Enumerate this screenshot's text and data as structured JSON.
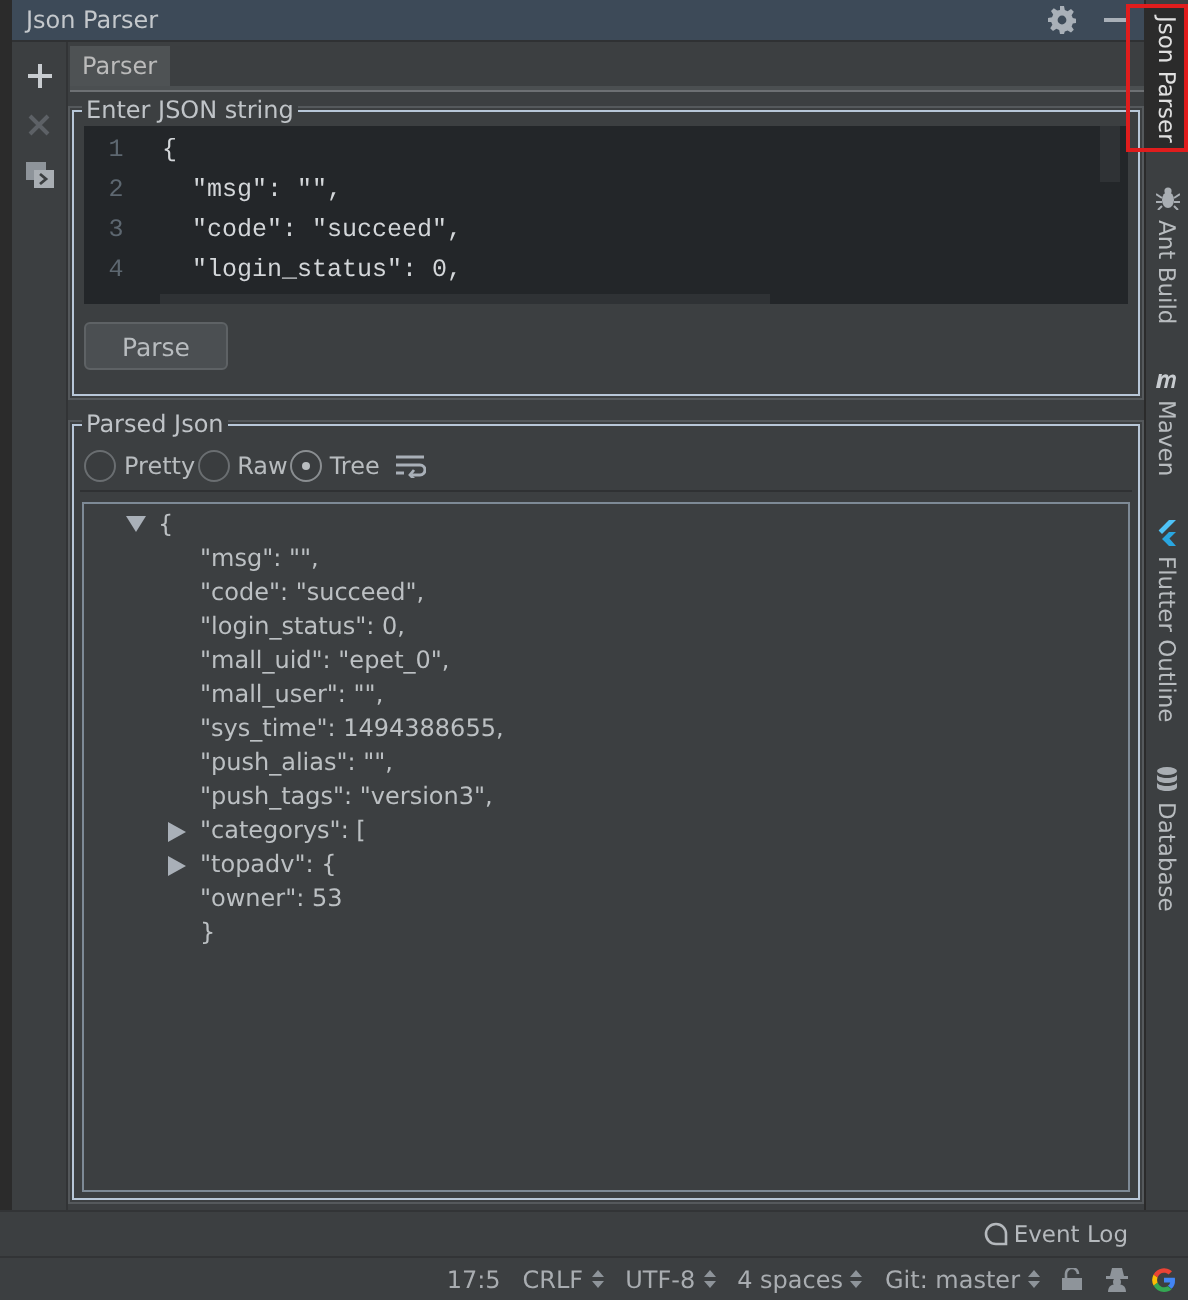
{
  "window": {
    "title": "Json Parser"
  },
  "tabs": [
    {
      "label": "Parser",
      "selected": true
    }
  ],
  "input_group": {
    "title": "Enter JSON string",
    "lines": [
      {
        "number": "1",
        "text": "{"
      },
      {
        "number": "2",
        "text": "  \"msg\": \"\","
      },
      {
        "number": "3",
        "text": "  \"code\": \"succeed\","
      },
      {
        "number": "4",
        "text": "  \"login_status\": 0,"
      }
    ]
  },
  "parse_button": "Parse",
  "output_group": {
    "title": "Parsed Json",
    "view_modes": [
      {
        "label": "Pretty",
        "selected": false
      },
      {
        "label": "Raw",
        "selected": false
      },
      {
        "label": "Tree",
        "selected": true
      }
    ]
  },
  "tree": {
    "open": "{",
    "expanded": true,
    "close": "}",
    "children": [
      {
        "kind": "leaf",
        "text": "\"msg\": \"\","
      },
      {
        "kind": "leaf",
        "text": "\"code\": \"succeed\","
      },
      {
        "kind": "leaf",
        "text": "\"login_status\": 0,"
      },
      {
        "kind": "leaf",
        "text": "\"mall_uid\": \"epet_0\","
      },
      {
        "kind": "leaf",
        "text": "\"mall_user\": \"\","
      },
      {
        "kind": "leaf",
        "text": "\"sys_time\": 1494388655,"
      },
      {
        "kind": "leaf",
        "text": "\"push_alias\": \"\","
      },
      {
        "kind": "leaf",
        "text": "\"push_tags\": \"version3\","
      },
      {
        "kind": "node",
        "text": "\"categorys\": [",
        "expanded": false
      },
      {
        "kind": "node",
        "text": "\"topadv\": {",
        "expanded": false
      },
      {
        "kind": "leaf",
        "text": "\"owner\": 53"
      }
    ]
  },
  "right_tabs": [
    {
      "label": "Json Parser",
      "selected": true,
      "highlighted": true,
      "kind": "none"
    },
    {
      "label": "Ant Build",
      "selected": false,
      "highlighted": false,
      "kind": "ant"
    },
    {
      "label": "Maven",
      "selected": false,
      "highlighted": false,
      "kind": "maven"
    },
    {
      "label": "Flutter Outline",
      "selected": false,
      "highlighted": false,
      "kind": "flutter"
    },
    {
      "label": "Database",
      "selected": false,
      "highlighted": false,
      "kind": "database"
    }
  ],
  "status_bar": {
    "event_log": "Event Log",
    "items": [
      {
        "text": "17:5",
        "has_menu": false
      },
      {
        "text": "CRLF",
        "has_menu": true
      },
      {
        "text": "UTF-8",
        "has_menu": true
      },
      {
        "text": "4 spaces",
        "has_menu": true
      },
      {
        "text": "Git: master",
        "has_menu": true
      }
    ]
  }
}
